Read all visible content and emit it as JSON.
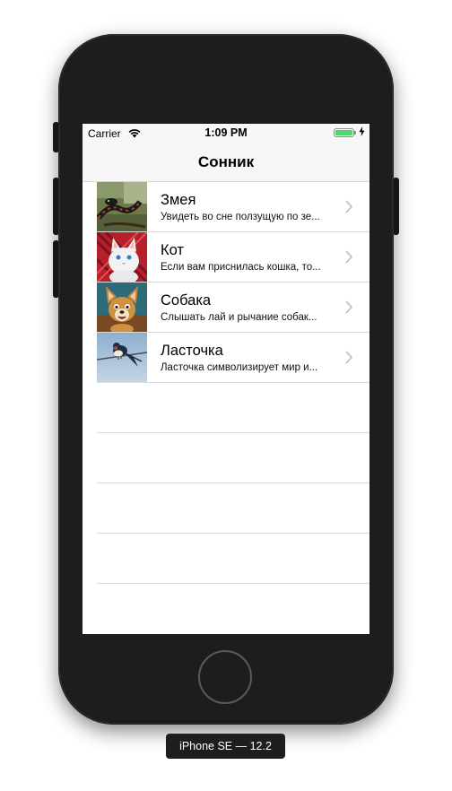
{
  "status_bar": {
    "carrier": "Carrier",
    "time": "1:09 PM",
    "battery_level": 1.0,
    "battery_color": "#4cd964",
    "wifi_icon": "wifi-icon",
    "charging_icon": "bolt-icon"
  },
  "nav": {
    "title": "Сонник"
  },
  "items": [
    {
      "title": "Змея",
      "subtitle": "Увидеть во сне ползущую по зе...",
      "thumbnail": "snake-image",
      "accessory": "chevron-right-icon"
    },
    {
      "title": "Кот",
      "subtitle": "Если вам приснилась кошка, то...",
      "thumbnail": "cat-image",
      "accessory": "chevron-right-icon"
    },
    {
      "title": "Собака",
      "subtitle": "Слышать лай и рычание собак...",
      "thumbnail": "dog-image",
      "accessory": "chevron-right-icon"
    },
    {
      "title": "Ласточка",
      "subtitle": "Ласточка символизирует мир и...",
      "thumbnail": "swallow-image",
      "accessory": "chevron-right-icon"
    }
  ],
  "device": {
    "label": "iPhone SE — 12.2"
  }
}
